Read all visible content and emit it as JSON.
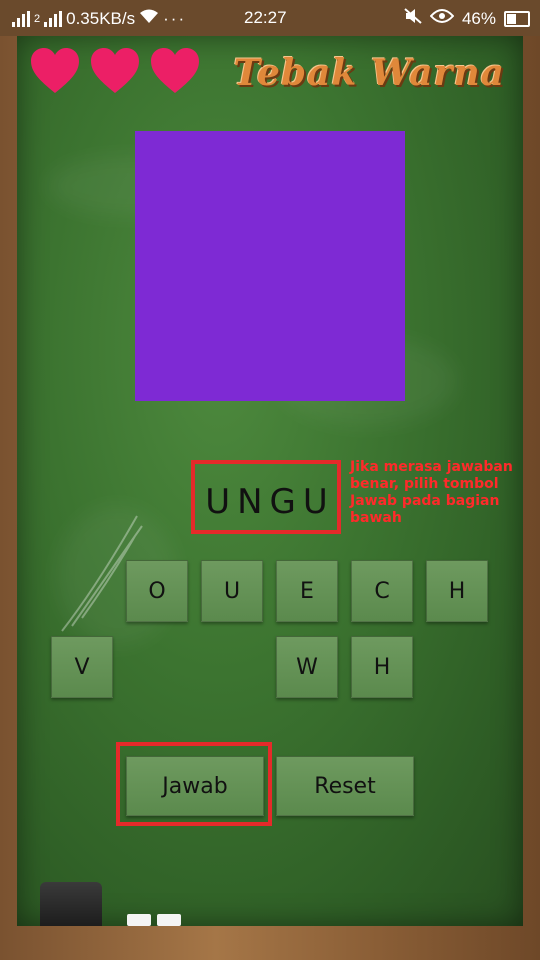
{
  "status_bar": {
    "network_speed": "0.35KB/s",
    "time": "22:27",
    "battery": "46%",
    "sim_label": "2"
  },
  "lives": {
    "count": 3,
    "color": "#ec1f66"
  },
  "title": "Tebak Warna",
  "target_color": "#7e2ad4",
  "answer": {
    "text": "UNGU"
  },
  "hint": "Jika merasa jawaban benar, pilih tombol Jawab pada bagian bawah",
  "letter_tiles": {
    "row1": [
      "O",
      "U",
      "E",
      "C",
      "H"
    ],
    "row2": [
      "V",
      "W",
      "H"
    ]
  },
  "buttons": {
    "jawab": "Jawab",
    "reset": "Reset"
  },
  "colors": {
    "highlight": "#e52a2a",
    "board": "#3c7430",
    "frame": "#8a5e36"
  }
}
